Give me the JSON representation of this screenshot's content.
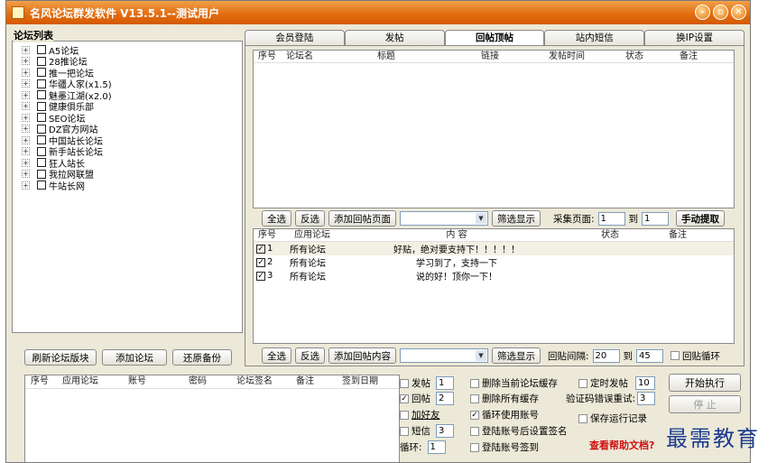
{
  "window": {
    "title": "名风论坛群发软件 V13.5.1--测试用户"
  },
  "forum_list": {
    "label": "论坛列表",
    "items": [
      "A5论坛",
      "28推论坛",
      "推一把论坛",
      "华疆人家(x1.5)",
      "魅墨江湖(x2.0)",
      "健康俱乐部",
      "SEO论坛",
      "DZ官方网站",
      "中国站长论坛",
      "新手站长论坛",
      "狂人站长",
      "我拉网联盟",
      "牛站长网"
    ]
  },
  "left_buttons": {
    "refresh": "刷新论坛版块",
    "add": "添加论坛",
    "restore": "还原备份"
  },
  "tabs": [
    "会员登陆",
    "发帖",
    "回帖顶帖",
    "站内短信",
    "换IP设置"
  ],
  "post_table": {
    "headers": [
      "序号",
      "论坛名",
      "标题",
      "链接",
      "发帖时间",
      "状态",
      "备注"
    ]
  },
  "toolbar1": {
    "select_all": "全选",
    "invert": "反选",
    "add_page": "添加回帖页面",
    "filter": "筛选显示",
    "collect_label": "采集页面:",
    "from": "1",
    "to_label": "到",
    "to": "1",
    "manual": "手动提取"
  },
  "reply_table": {
    "headers": [
      "序号",
      "应用论坛",
      "内 容",
      "状态",
      "备注"
    ],
    "rows": [
      {
        "no": "1",
        "forum": "所有论坛",
        "content": "好贴，绝对要支持下！！！！！"
      },
      {
        "no": "2",
        "forum": "所有论坛",
        "content": "学习到了，支持一下"
      },
      {
        "no": "3",
        "forum": "所有论坛",
        "content": "说的好！顶你一下！"
      }
    ]
  },
  "toolbar2": {
    "select_all": "全选",
    "invert": "反选",
    "add_content": "添加回帖内容",
    "filter": "筛选显示",
    "interval_label": "回贴间隔:",
    "from": "20",
    "to_label": "到",
    "to": "45",
    "loop": "回贴循环"
  },
  "account_table": {
    "headers": [
      "序号",
      "应用论坛",
      "账号",
      "密码",
      "论坛签名",
      "备注",
      "签到日期"
    ]
  },
  "options": {
    "post": {
      "label": "发帖",
      "value": "1"
    },
    "reply": {
      "label": "回帖",
      "value": "2"
    },
    "add_friend": {
      "label": "加好友"
    },
    "message": {
      "label": "短信",
      "value": "3"
    },
    "loop": {
      "label": "循环:",
      "value": "1"
    },
    "clear_cache": "删除当前论坛缓存",
    "clear_all_cache": "删除所有缓存",
    "cycle_accounts": "循环使用账号",
    "set_signature": "登陆账号后设置签名",
    "checkin": "登陆账号签到",
    "scheduled": {
      "label": "定时发帖",
      "value": "10"
    },
    "captcha_retry": {
      "label": "验证码错误重试:",
      "value": "3"
    },
    "save_log": "保存运行记录"
  },
  "actions": {
    "start": "开始执行",
    "stop": "停 止"
  },
  "help": "查看帮助文档?",
  "watermark": "最需教育"
}
